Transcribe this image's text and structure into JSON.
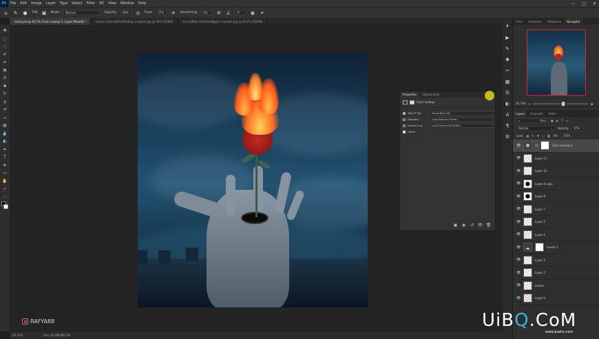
{
  "menubar": {
    "logo": "Ps",
    "items": [
      "File",
      "Edit",
      "Image",
      "Layer",
      "Type",
      "Select",
      "Filter",
      "3D",
      "View",
      "Window",
      "Help"
    ],
    "controls": [
      "—",
      "□",
      "✕"
    ]
  },
  "options": {
    "brush_size": "700",
    "mode_label": "Mode:",
    "mode_value": "Normal",
    "opacity_label": "Opacity:",
    "opacity_value": "69%",
    "flow_label": "Flow:",
    "flow_value": "57%",
    "smoothing_label": "Smoothing:",
    "smoothing_value": "2%",
    "angle_value": "0°"
  },
  "doc_tabs": [
    {
      "label": "rose2.psd @ 40,7% (Color Lookup 1, Layer Mask/8) *",
      "active": true
    },
    {
      "label": "callum smith 8dFhuR0e0sg unsplash.jpg @ 50% (RGB/8)",
      "active": false
    },
    {
      "label": "lisa keffdka OUHXAcN8gp4 unsplash.jpg @ 20,2% (RGB/8)",
      "active": false
    }
  ],
  "watermark_left": "RAFYA88",
  "statusbar": {
    "zoom": "40,74%",
    "doc": "Doc: 65,9M/385,1M"
  },
  "properties": {
    "tabs": [
      "Properties",
      "Adjustments"
    ],
    "title": "Color Lookup",
    "rows": [
      {
        "label": "3DLUT File",
        "value": "HorrorBlue.3DL",
        "on": true
      },
      {
        "label": "Abstract",
        "value": "Load Abstract Profile...",
        "on": false
      },
      {
        "label": "Device Link",
        "value": "Load DeviceLink Profile...",
        "on": false
      }
    ],
    "dither_label": "Dither"
  },
  "right_panel": {
    "top_tabs": [
      "Color",
      "Swatches",
      "Histogram",
      "Navigator"
    ],
    "zoom": "40,74%",
    "layer_tabs": [
      "Layers",
      "Channels",
      "Paths"
    ],
    "kind_label": "Kind",
    "blend_mode": "Normal",
    "opacity_label": "Opacity:",
    "opacity_value": "97%",
    "lock_label": "Lock:",
    "fill_label": "Fill:",
    "fill_value": "100%",
    "layers": [
      {
        "name": "Color Lookup 1",
        "type": "adj",
        "selected": true
      },
      {
        "name": "Layer 11",
        "type": "pixel",
        "selected": false
      },
      {
        "name": "Layer 10",
        "type": "pixel",
        "selected": false
      },
      {
        "name": "Layer 8 copy",
        "type": "dark",
        "selected": false
      },
      {
        "name": "Layer 8",
        "type": "dark",
        "selected": false
      },
      {
        "name": "Layer 7",
        "type": "pixel",
        "selected": false
      },
      {
        "name": "Layer 5",
        "type": "pixel",
        "selected": false
      },
      {
        "name": "Layer 4",
        "type": "pixel",
        "selected": false
      },
      {
        "name": "Levels 2",
        "type": "adj",
        "selected": false
      },
      {
        "name": "Layer 3",
        "type": "pixel",
        "selected": false
      },
      {
        "name": "Layer 2",
        "type": "pixel",
        "selected": false
      },
      {
        "name": "Levels",
        "type": "pixel",
        "selected": false
      },
      {
        "name": "Layer 9",
        "type": "pinkish",
        "selected": false
      }
    ]
  },
  "watermark_right": {
    "text_a": "UiB",
    "text_o": "Q",
    "text_b": ".CoM",
    "sub": "www.psahz.com"
  },
  "colors": {
    "accent_selection": "#e0243a",
    "cursor": "#e1d21e"
  }
}
